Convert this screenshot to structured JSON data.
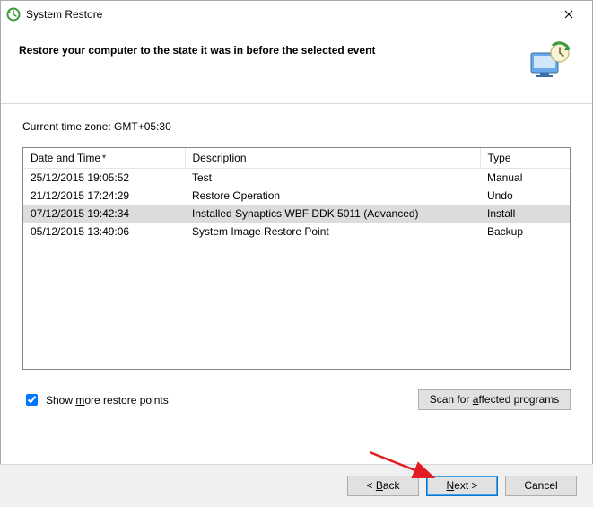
{
  "window": {
    "title": "System Restore"
  },
  "header": {
    "headline": "Restore your computer to the state it was in before the selected event"
  },
  "timezone_label": "Current time zone: GMT+05:30",
  "table": {
    "columns": {
      "datetime": "Date and Time",
      "description": "Description",
      "type": "Type"
    },
    "rows": [
      {
        "datetime": "25/12/2015 19:05:52",
        "description": "Test",
        "type": "Manual",
        "selected": false
      },
      {
        "datetime": "21/12/2015 17:24:29",
        "description": "Restore Operation",
        "type": "Undo",
        "selected": false
      },
      {
        "datetime": "07/12/2015 19:42:34",
        "description": "Installed Synaptics WBF DDK 5011 (Advanced)",
        "type": "Install",
        "selected": true
      },
      {
        "datetime": "05/12/2015 13:49:06",
        "description": "System Image Restore Point",
        "type": "Backup",
        "selected": false
      }
    ]
  },
  "checkbox": {
    "label_pre": "Show ",
    "label_key": "m",
    "label_post": "ore restore points",
    "checked": true
  },
  "buttons": {
    "scan_pre": "Scan for ",
    "scan_key": "a",
    "scan_post": "ffected programs",
    "back_pre": "< ",
    "back_key": "B",
    "back_post": "ack",
    "next_key": "N",
    "next_post": "ext >",
    "cancel": "Cancel"
  }
}
